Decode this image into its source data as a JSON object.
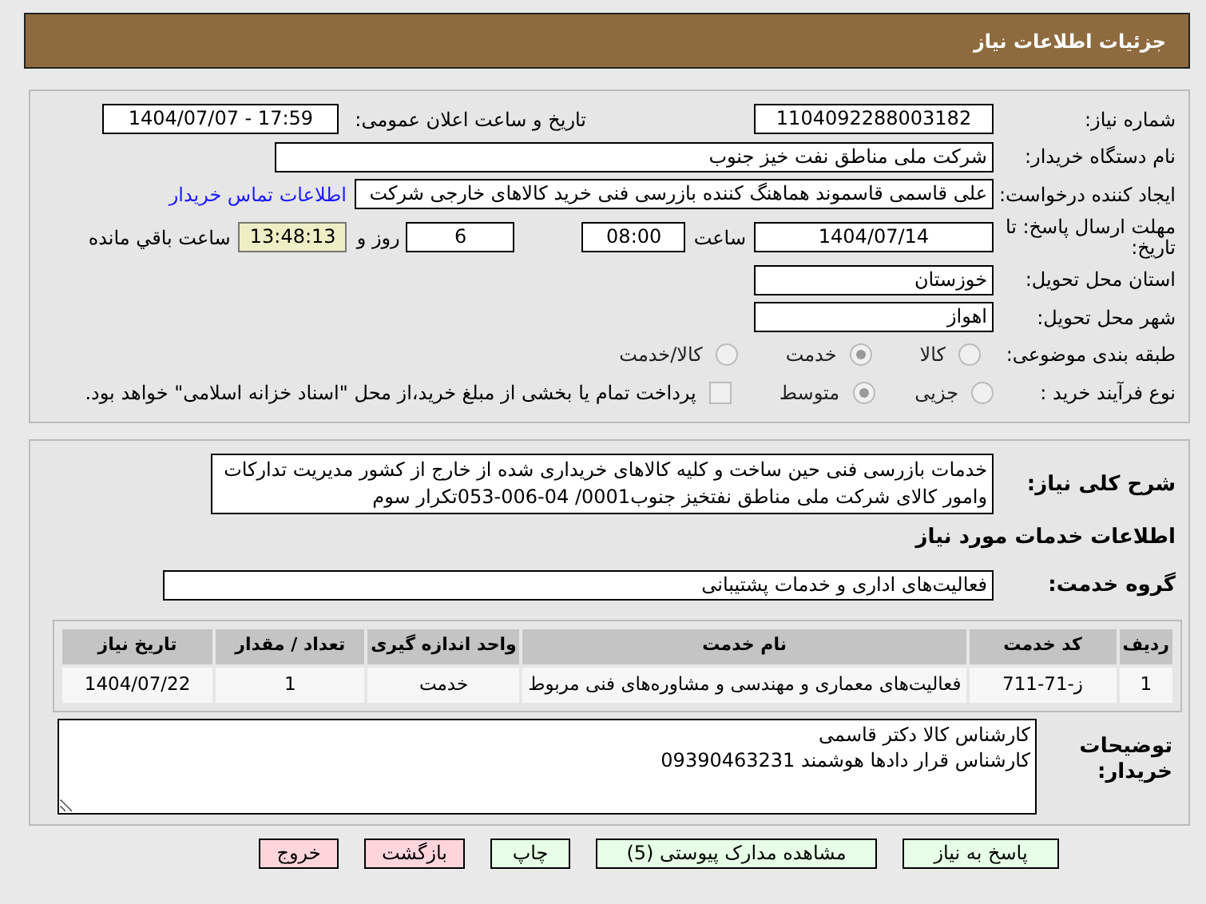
{
  "header": {
    "title": "جزئیات اطلاعات نیاز"
  },
  "need_number": {
    "label": "شماره نیاز:",
    "value": "1104092288003182"
  },
  "announce": {
    "label": "تاریخ و ساعت اعلان عمومی:",
    "value": "1404/07/07 - 17:59"
  },
  "buyer": {
    "label": "نام دستگاه خریدار:",
    "value": "شرکت ملی مناطق نفت خیز جنوب"
  },
  "creator": {
    "label": "ایجاد کننده درخواست:",
    "value": "علی قاسمی قاسموند هماهنگ کننده بازرسی فنی خرید کالاهای خارجی شرکت",
    "link": "اطلاعات تماس خریدار"
  },
  "deadline": {
    "label": "مهلت ارسال پاسخ: تا تاریخ:",
    "date": "1404/07/14",
    "time_label": "ساعت",
    "time": "08:00",
    "days": "6",
    "days_label": "روز و",
    "remaining": "13:48:13",
    "remaining_label": "ساعت باقي مانده"
  },
  "province": {
    "label": "استان محل تحویل:",
    "value": "خوزستان"
  },
  "city": {
    "label": "شهر محل تحویل:",
    "value": "اهواز"
  },
  "category": {
    "label": "طبقه بندی موضوعی:",
    "options": [
      {
        "label": "کالا",
        "selected": false
      },
      {
        "label": "خدمت",
        "selected": true
      },
      {
        "label": "کالا/خدمت",
        "selected": false
      }
    ]
  },
  "process": {
    "label": "نوع فرآیند خرید :",
    "options": [
      {
        "label": "جزیی",
        "selected": false
      },
      {
        "label": "متوسط",
        "selected": true
      }
    ],
    "payment_checked": false,
    "payment_note": "پرداخت تمام یا بخشی از مبلغ خرید،از محل \"اسناد خزانه اسلامی\" خواهد بود."
  },
  "summary": {
    "label": "شرح کلی نیاز:",
    "value": "خدمات بازرسی فنی حین ساخت و کلیه کالاهای خریداری شده از خارج از کشور مدیریت تدارکات وامور کالای شرکت ملی مناطق نفتخیز جنوب0001/ 04-006-053تکرار سوم"
  },
  "services_heading": "اطلاعات خدمات مورد نیاز",
  "service_group": {
    "label": "گروه خدمت:",
    "value": "فعالیت‌های اداری و خدمات پشتیبانی"
  },
  "table": {
    "columns": [
      "ردیف",
      "کد خدمت",
      "نام خدمت",
      "واحد اندازه گیری",
      "تعداد / مقدار",
      "تاریخ نیاز"
    ],
    "rows": [
      [
        "1",
        "ز-71-711",
        "فعالیت‌های معماری و مهندسی و مشاوره‌های فنی مربوط",
        "خدمت",
        "1",
        "1404/07/22"
      ]
    ]
  },
  "buyer_notes": {
    "label": "توضیحات خریدار:",
    "value": "کارشناس کالا دکتر قاسمی\nکارشناس قرار دادها هوشمند 09390463231"
  },
  "buttons": [
    {
      "label": "پاسخ به نیاز",
      "color": "#e6ffe6"
    },
    {
      "label": "مشاهده مدارک پیوستی (5)",
      "color": "#e6ffe6"
    },
    {
      "label": "چاپ",
      "color": "#e6ffe6"
    },
    {
      "label": "بازگشت",
      "color": "#ffd5dc"
    },
    {
      "label": "خروج",
      "color": "#ffd5dc"
    }
  ]
}
